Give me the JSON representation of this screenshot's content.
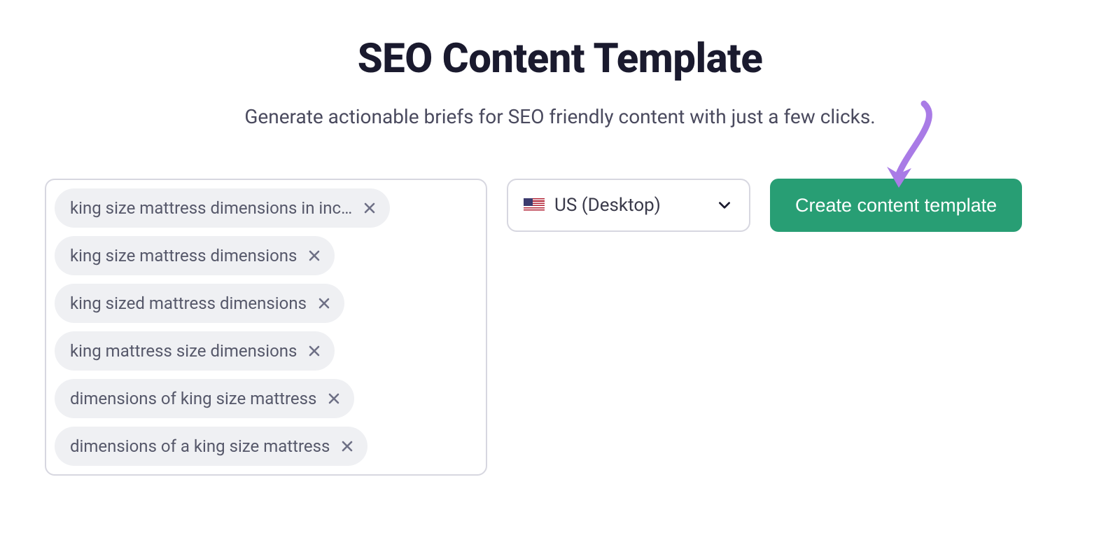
{
  "header": {
    "title": "SEO Content Template",
    "subtitle": "Generate actionable briefs for SEO friendly content with just a few clicks."
  },
  "keywords": [
    "king size mattress dimensions in inc…",
    "king size mattress dimensions",
    "king sized mattress dimensions",
    "king mattress size dimensions",
    "dimensions of king size mattress",
    "dimensions of a king size mattress"
  ],
  "region": {
    "label": "US (Desktop)"
  },
  "actions": {
    "create_label": "Create content template"
  }
}
